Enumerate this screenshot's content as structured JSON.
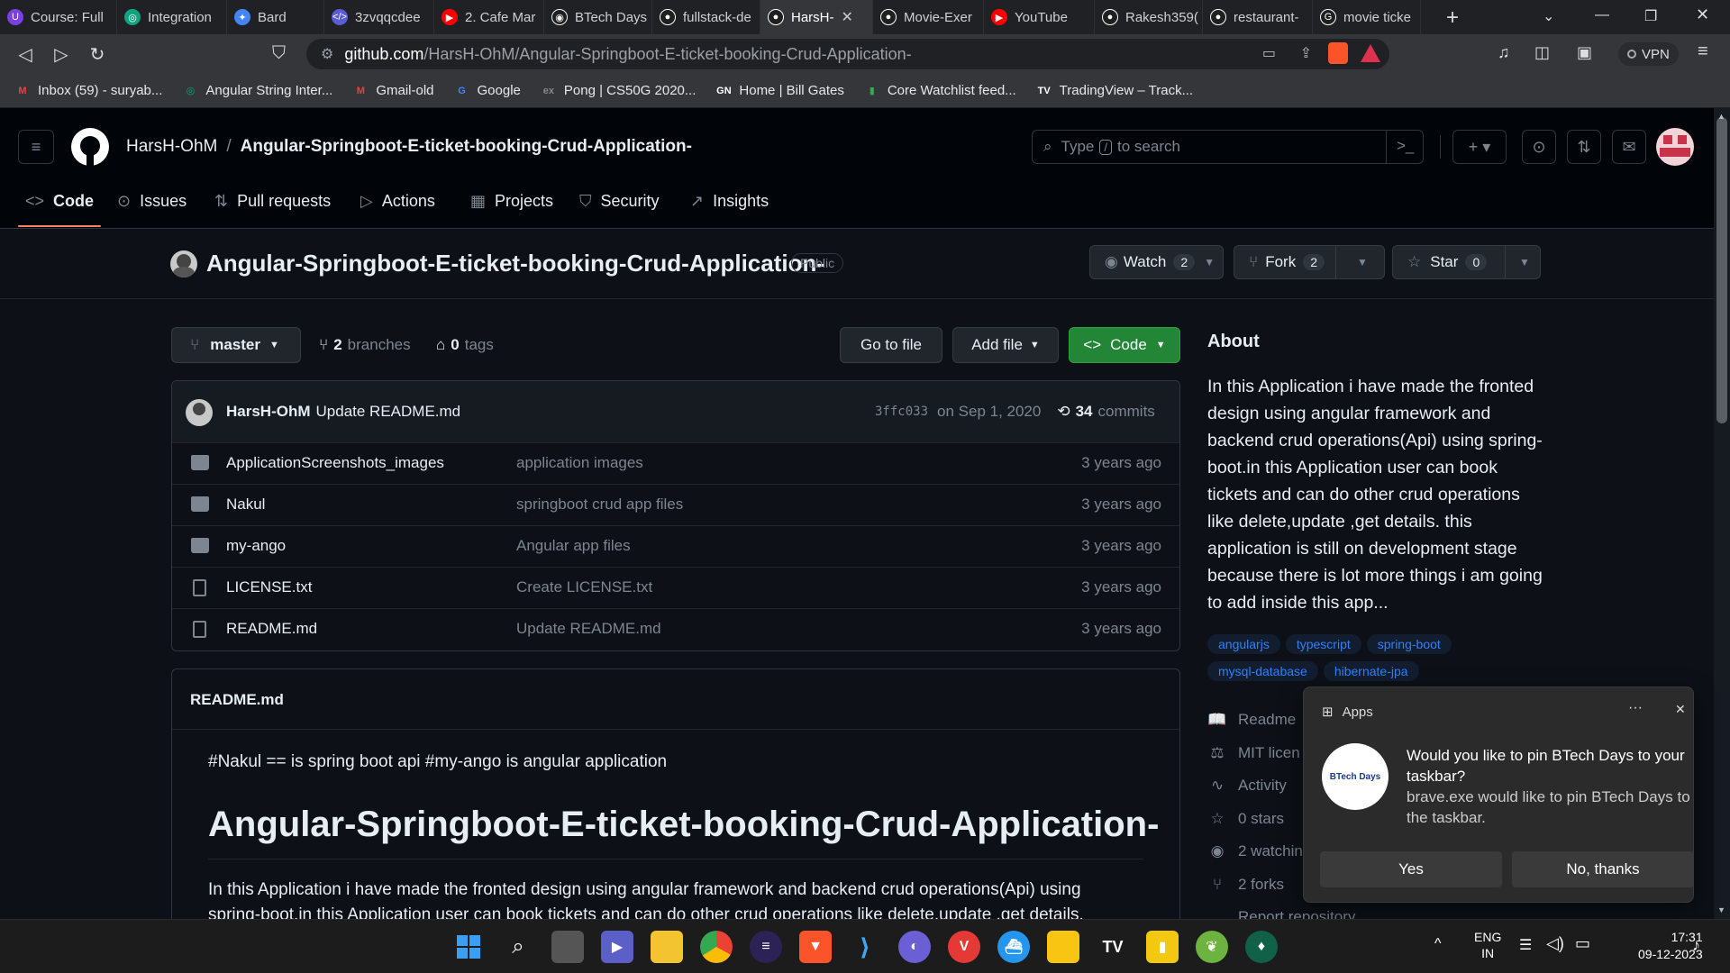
{
  "browser": {
    "tabs": [
      {
        "label": "Course: Full",
        "color": "#7b3fe4",
        "glyph": "U"
      },
      {
        "label": "Integration",
        "color": "#10a37f",
        "glyph": "◎"
      },
      {
        "label": "Bard",
        "color": "#4285f4",
        "glyph": "✦"
      },
      {
        "label": "3zvqqcdee",
        "color": "#5b5bd6",
        "glyph": "</>"
      },
      {
        "label": "2. Cafe Mar",
        "color": "#ff0000",
        "glyph": "▶"
      },
      {
        "label": "BTech Days",
        "color": "#f1f1f1",
        "glyph": "◉"
      },
      {
        "label": "fullstack-de",
        "color": "#ffffff",
        "glyph": "●"
      },
      {
        "label": "HarsH-",
        "color": "#ffffff",
        "glyph": "●"
      },
      {
        "label": "Movie-Exer",
        "color": "#ffffff",
        "glyph": "●"
      },
      {
        "label": "YouTube",
        "color": "#ff0000",
        "glyph": "▶"
      },
      {
        "label": "Rakesh359(",
        "color": "#ffffff",
        "glyph": "●"
      },
      {
        "label": "restaurant-",
        "color": "#ffffff",
        "glyph": "●"
      },
      {
        "label": "movie ticke",
        "color": "#ffffff",
        "glyph": "G"
      }
    ],
    "url_host": "github.com",
    "url_path": "/HarsH-OhM/Angular-Springboot-E-ticket-booking-Crud-Application-",
    "vpn_label": "VPN",
    "bookmarks": [
      {
        "label": "Inbox (59) - suryab...",
        "icon": "M",
        "color": "#ea4335"
      },
      {
        "label": "Angular String Inter...",
        "icon": "◎",
        "color": "#10a37f"
      },
      {
        "label": "Gmail-old",
        "icon": "M",
        "color": "#ea4335"
      },
      {
        "label": "Google",
        "icon": "G",
        "color": "#4285f4"
      },
      {
        "label": "Pong | CS50G 2020...",
        "icon": "ex",
        "color": "#888888"
      },
      {
        "label": "Home | Bill Gates",
        "icon": "GN",
        "color": "#ffffff"
      },
      {
        "label": "Core Watchlist feed...",
        "icon": "▮",
        "color": "#34a853"
      },
      {
        "label": "TradingView – Track...",
        "icon": "TV",
        "color": "#ffffff"
      }
    ]
  },
  "github": {
    "owner": "HarsH-OhM",
    "separator": "/",
    "repo": "Angular-Springboot-E-ticket-booking-Crud-Application-",
    "search_prefix": "Type",
    "search_key": "/",
    "search_suffix": "to search",
    "nav": [
      {
        "label": "Code",
        "icon": "<>"
      },
      {
        "label": "Issues",
        "icon": "⊙"
      },
      {
        "label": "Pull requests",
        "icon": "⇅"
      },
      {
        "label": "Actions",
        "icon": "▷"
      },
      {
        "label": "Projects",
        "icon": "▦"
      },
      {
        "label": "Security",
        "icon": "⛉"
      },
      {
        "label": "Insights",
        "icon": "↗"
      }
    ],
    "visibility": "Public",
    "watch_label": "Watch",
    "watch_count": "2",
    "fork_label": "Fork",
    "fork_count": "2",
    "star_label": "Star",
    "star_count": "0",
    "branch": "master",
    "branches_count": "2",
    "branches_label": "branches",
    "tags_count": "0",
    "tags_label": "tags",
    "goto_file": "Go to file",
    "add_file": "Add file",
    "code_button": "Code",
    "commit": {
      "author": "HarsH-OhM",
      "message": "Update README.md",
      "hash": "3ffc033",
      "date": "on Sep 1, 2020",
      "count": "34",
      "count_label": "commits"
    },
    "files": [
      {
        "name": "ApplicationScreenshots_images",
        "message": "application images",
        "time": "3 years ago",
        "type": "dir"
      },
      {
        "name": "Nakul",
        "message": "springboot crud app files",
        "time": "3 years ago",
        "type": "dir"
      },
      {
        "name": "my-ango",
        "message": "Angular app files",
        "time": "3 years ago",
        "type": "dir"
      },
      {
        "name": "LICENSE.txt",
        "message": "Create LICENSE.txt",
        "time": "3 years ago",
        "type": "file"
      },
      {
        "name": "README.md",
        "message": "Update README.md",
        "time": "3 years ago",
        "type": "file"
      }
    ],
    "readme": {
      "title": "README.md",
      "line1": "#Nakul == is spring boot api #my-ango is angular application",
      "heading": "Angular-Springboot-E-ticket-booking-Crud-Application-",
      "para_line1": "In this Application i have made the fronted design using angular framework and backend crud operations(Api) using",
      "para_line2": "spring-boot.in this Application user can book tickets and can do other crud operations like delete,update ,get details."
    },
    "about": {
      "heading": "About",
      "description": "In this Application i have made the fronted design using angular framework and backend crud operations(Api) using spring-boot.in this Application user can book tickets and can do other crud operations like delete,update ,get details. this application is still on development stage because there is lot more things i am going to add inside this app...",
      "topics": [
        "angularjs",
        "typescript",
        "spring-boot",
        "mysql-database",
        "hibernate-jpa"
      ],
      "links": [
        {
          "label": "Readme",
          "icon": "📖"
        },
        {
          "label": "MIT licen",
          "icon": "⚖"
        },
        {
          "label": "Activity",
          "icon": "∿"
        },
        {
          "label": "0 stars",
          "icon": "☆"
        },
        {
          "label": "2 watchin",
          "icon": "◉"
        },
        {
          "label": "2 forks",
          "icon": "⑂"
        },
        {
          "label": "Report repository",
          "icon": ""
        }
      ]
    }
  },
  "notification": {
    "app": "Apps",
    "title": "Would you like to pin BTech Days to your taskbar?",
    "body": "brave.exe would like to pin BTech Days to the taskbar.",
    "logo_text": "BTech Days",
    "yes": "Yes",
    "no": "No, thanks",
    "more": "···",
    "close": "✕"
  },
  "taskbar": {
    "lang": "ENG",
    "region": "IN",
    "time": "17:31",
    "date": "09-12-2023"
  }
}
